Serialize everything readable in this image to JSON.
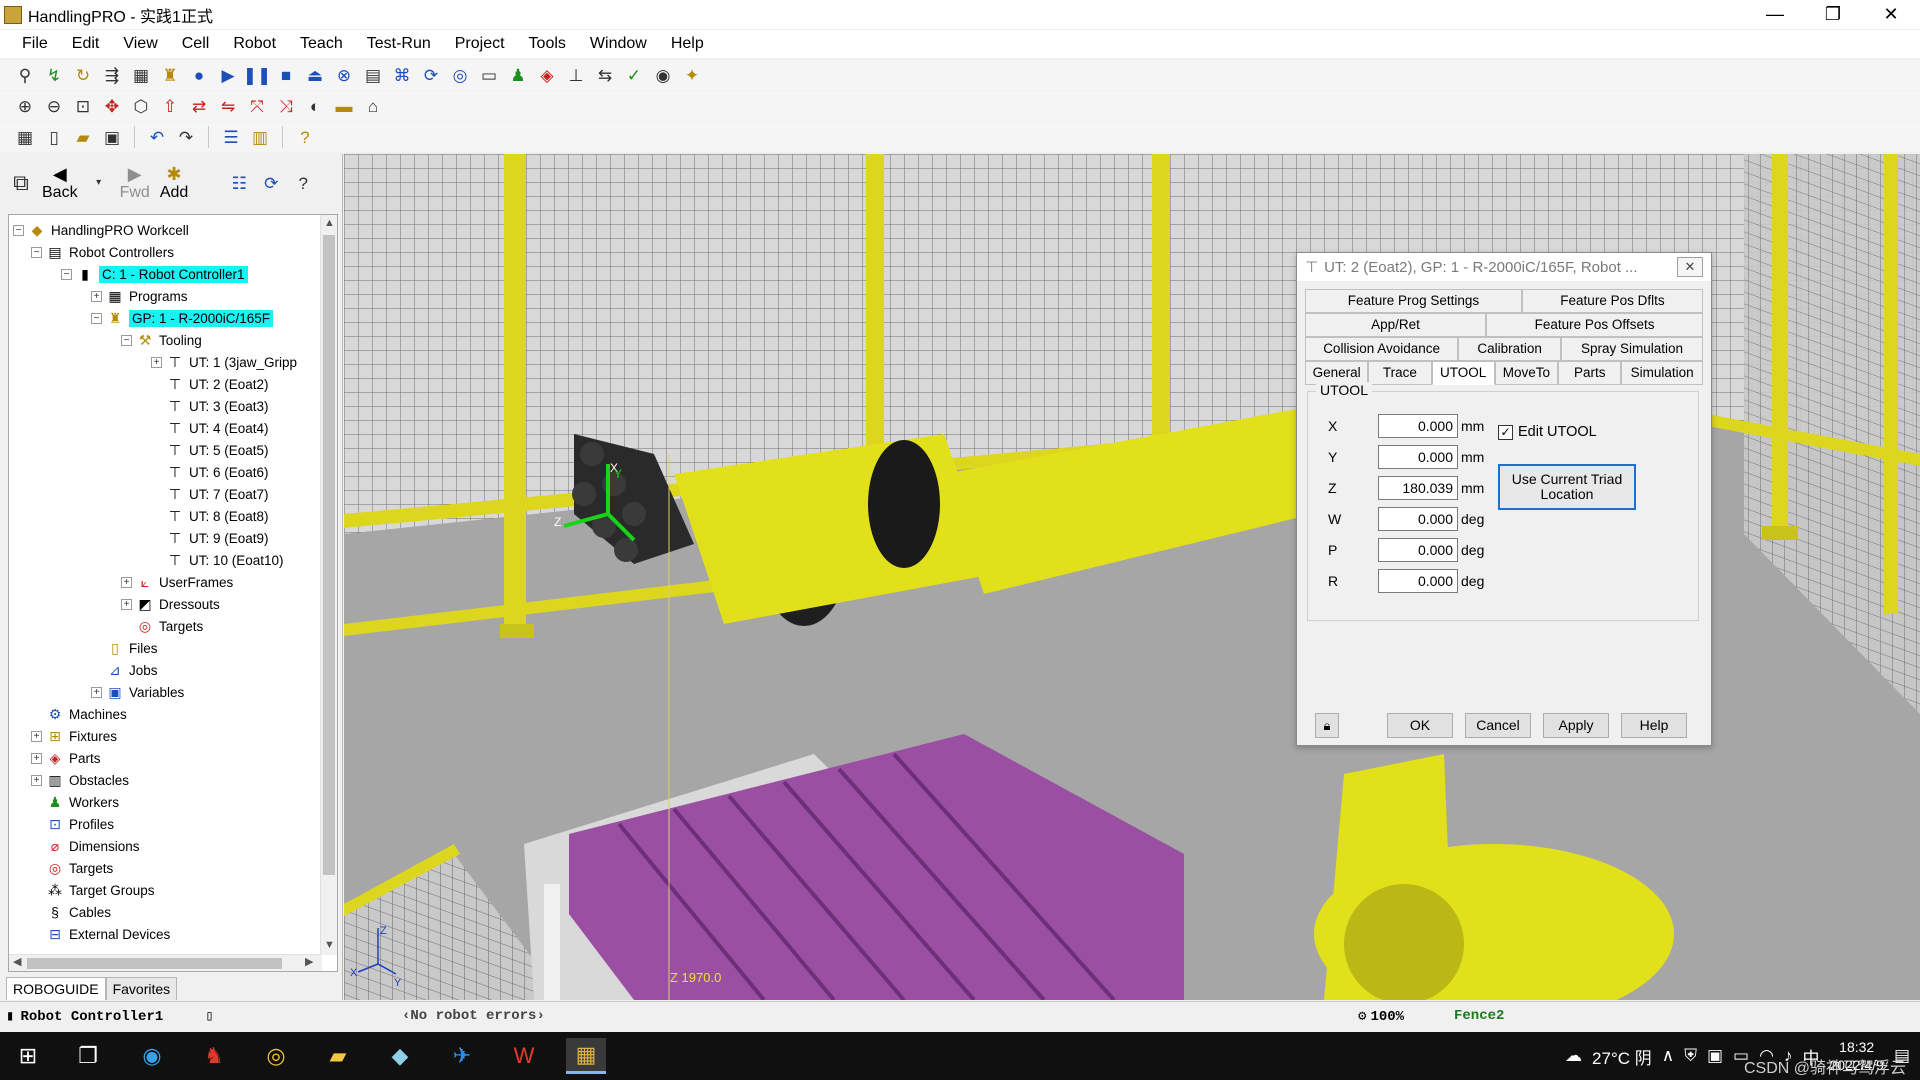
{
  "window": {
    "title": "HandlingPRO - 实践1正式",
    "minimize": "—",
    "restore": "❐",
    "close": "✕"
  },
  "menu": [
    "File",
    "Edit",
    "View",
    "Cell",
    "Robot",
    "Teach",
    "Test-Run",
    "Project",
    "Tools",
    "Window",
    "Help"
  ],
  "nav": {
    "back_label": "Back",
    "fwd_label": "Fwd",
    "add_label": "Add"
  },
  "tree": {
    "root": "HandlingPRO Workcell",
    "robot_controllers": "Robot Controllers",
    "controller": "C: 1 - Robot Controller1",
    "programs": "Programs",
    "group": "GP: 1 - R-2000iC/165F",
    "tooling": "Tooling",
    "tools": [
      "UT: 1  (3jaw_Gripp",
      "UT: 2  (Eoat2)",
      "UT: 3  (Eoat3)",
      "UT: 4  (Eoat4)",
      "UT: 5  (Eoat5)",
      "UT: 6  (Eoat6)",
      "UT: 7  (Eoat7)",
      "UT: 8  (Eoat8)",
      "UT: 9  (Eoat9)",
      "UT: 10  (Eoat10)"
    ],
    "userframes": "UserFrames",
    "dressouts": "Dressouts",
    "targets_gp": "Targets",
    "files": "Files",
    "jobs": "Jobs",
    "variables": "Variables",
    "machines": "Machines",
    "fixtures": "Fixtures",
    "parts": "Parts",
    "obstacles": "Obstacles",
    "workers": "Workers",
    "profiles": "Profiles",
    "dimensions": "Dimensions",
    "targets": "Targets",
    "target_groups": "Target Groups",
    "cables": "Cables",
    "external_devices": "External Devices"
  },
  "panel_tabs": [
    "ROBOGUIDE",
    "Favorites"
  ],
  "viewport": {
    "z_readout": "Z 1970.0",
    "triad_x": "X",
    "triad_y": "Y",
    "triad_z": "Z",
    "axis_x": "X",
    "axis_y": "Y",
    "axis_z": "Z",
    "colors": {
      "robot_yellow": "#e2e01a",
      "pallet_purple": "#9b4fa3",
      "floor": "#a6a6a6",
      "fence_yellow": "#dcd61f"
    }
  },
  "dialog": {
    "title": "UT: 2  (Eoat2), GP: 1 - R-2000iC/165F, Robot ...",
    "tabs_row1": [
      "Feature Prog Settings",
      "Feature Pos Dflts"
    ],
    "tabs_row2": [
      "App/Ret",
      "Feature Pos Offsets"
    ],
    "tabs_row3": [
      "Collision Avoidance",
      "Calibration",
      "Spray Simulation"
    ],
    "tabs_row4": [
      "General",
      "Trace",
      "UTOOL",
      "MoveTo",
      "Parts",
      "Simulation"
    ],
    "active_tab": "UTOOL",
    "group_label": "UTOOL",
    "fields": [
      {
        "label": "X",
        "value": "0.000",
        "unit": "mm"
      },
      {
        "label": "Y",
        "value": "0.000",
        "unit": "mm"
      },
      {
        "label": "Z",
        "value": "180.039",
        "unit": "mm"
      },
      {
        "label": "W",
        "value": "0.000",
        "unit": "deg"
      },
      {
        "label": "P",
        "value": "0.000",
        "unit": "deg"
      },
      {
        "label": "R",
        "value": "0.000",
        "unit": "deg"
      }
    ],
    "edit_utool_label": "Edit UTOOL",
    "edit_utool_checked": true,
    "triad_button": "Use Current Triad Location",
    "ok": "OK",
    "cancel": "Cancel",
    "apply": "Apply",
    "help": "Help"
  },
  "status": {
    "controller": "Robot Controller1",
    "errors": "No robot errors",
    "zoom": "100%",
    "fence": "Fence2"
  },
  "taskbar": {
    "weather": "27°C 阴",
    "ime": "中",
    "time": "18:32",
    "date": "2022/4/9",
    "watermark": "CSDN @骑神马驾浮云"
  }
}
